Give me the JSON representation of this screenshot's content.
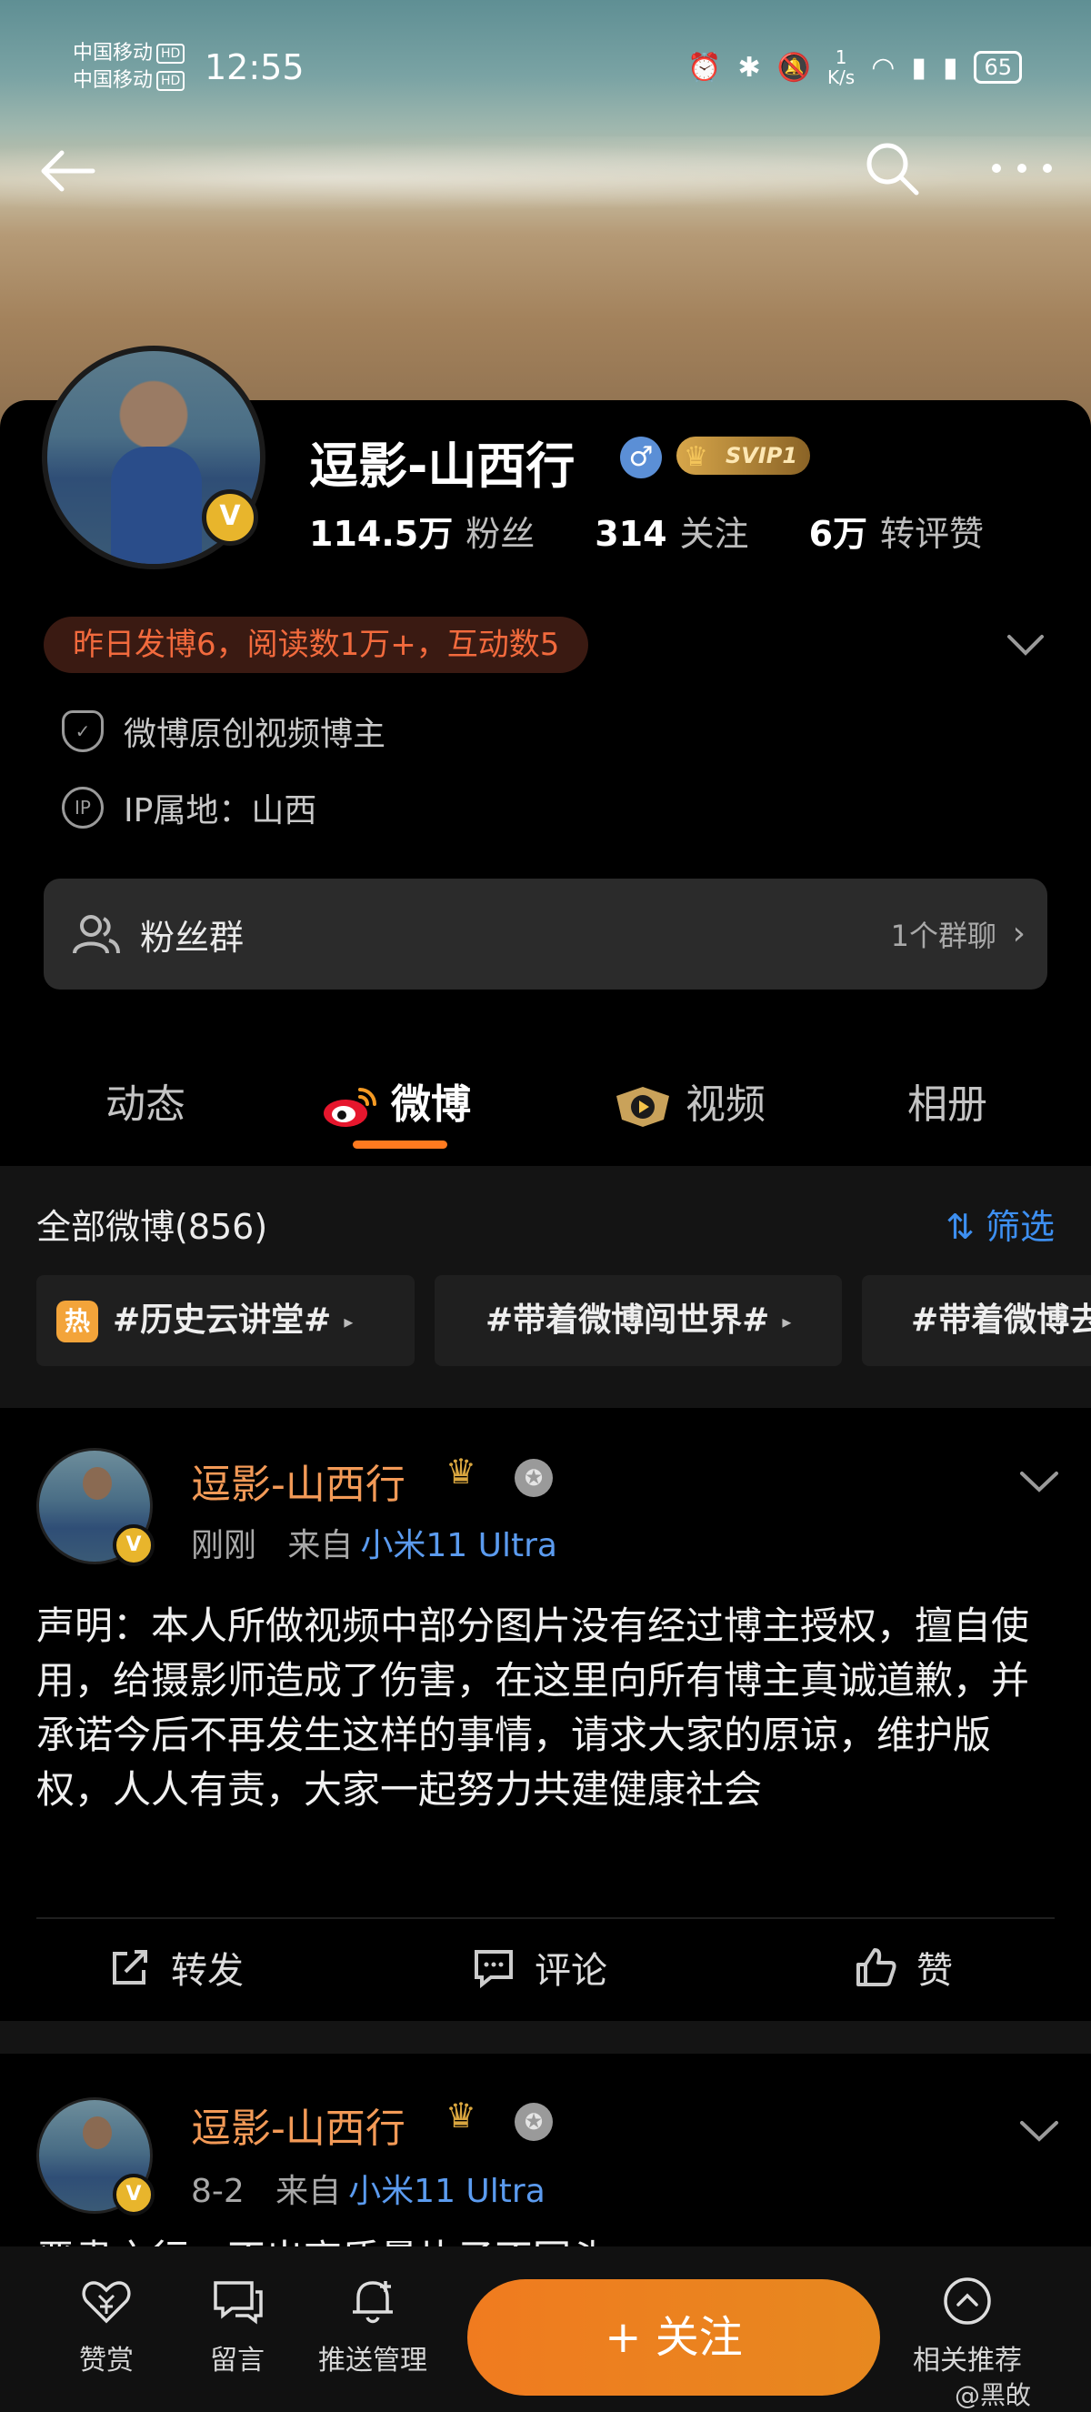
{
  "status_bar": {
    "carrier_1": "中国移动",
    "carrier_2": "中国移动",
    "hd_badge": "HD",
    "time": "12:55",
    "net_speed_value": "1",
    "net_speed_unit": "K/s",
    "battery": "65"
  },
  "profile": {
    "name": "逗影-山西行",
    "svip_label": "SVIP1",
    "verified_badge": "V",
    "stats": [
      {
        "value": "114.5万",
        "label": "粉丝"
      },
      {
        "value": "314",
        "label": "关注"
      },
      {
        "value": "6万",
        "label": "转评赞"
      }
    ],
    "activity_pill": "昨日发博6，阅读数1万+，互动数5",
    "certification": "微博原创视频博主",
    "ip_label": "IP属地：山西",
    "ip_icon": "IP",
    "fans_group": {
      "label": "粉丝群",
      "count": "1个群聊"
    }
  },
  "tabs": [
    {
      "label": "动态",
      "active": false
    },
    {
      "label": "微博",
      "active": true
    },
    {
      "label": "视频",
      "active": false
    },
    {
      "label": "相册",
      "active": false
    }
  ],
  "feed": {
    "all_label": "全部微博(856)",
    "filter_label": "筛选",
    "topics": [
      {
        "label": "#历史云讲堂#",
        "hot": "热"
      },
      {
        "label": "#带着微博闯世界#"
      },
      {
        "label": "#带着微博去"
      }
    ]
  },
  "posts": [
    {
      "author": "逗影-山西行",
      "time": "刚刚",
      "from": "来自",
      "device": "小米11 Ultra",
      "text": "声明：本人所做视频中部分图片没有经过博主授权，擅自使用，给摄影师造成了伤害，在这里向所有博主真诚道歉，并承诺今后不再发生这样的事情，请求大家的原谅，维护版权，人人有责，大家一起努力共建健康社会",
      "actions": {
        "repost": "转发",
        "comment": "评论",
        "like": "赞"
      }
    },
    {
      "author": "逗影-山西行",
      "time": "8-2",
      "from": "来自",
      "device": "小米11 Ultra",
      "text": "严肃之行，不出高质量片子不回头"
    }
  ],
  "bottom_bar": {
    "reward": "赞赏",
    "message": "留言",
    "push": "推送管理",
    "follow": "+ 关注",
    "related": "相关推荐"
  },
  "watermark": "@黑敀",
  "colors": {
    "accent_orange": "#f07b1f",
    "link_blue": "#3d8ff0",
    "author_orange": "#f39a57",
    "pill_text": "#f26a3d"
  }
}
